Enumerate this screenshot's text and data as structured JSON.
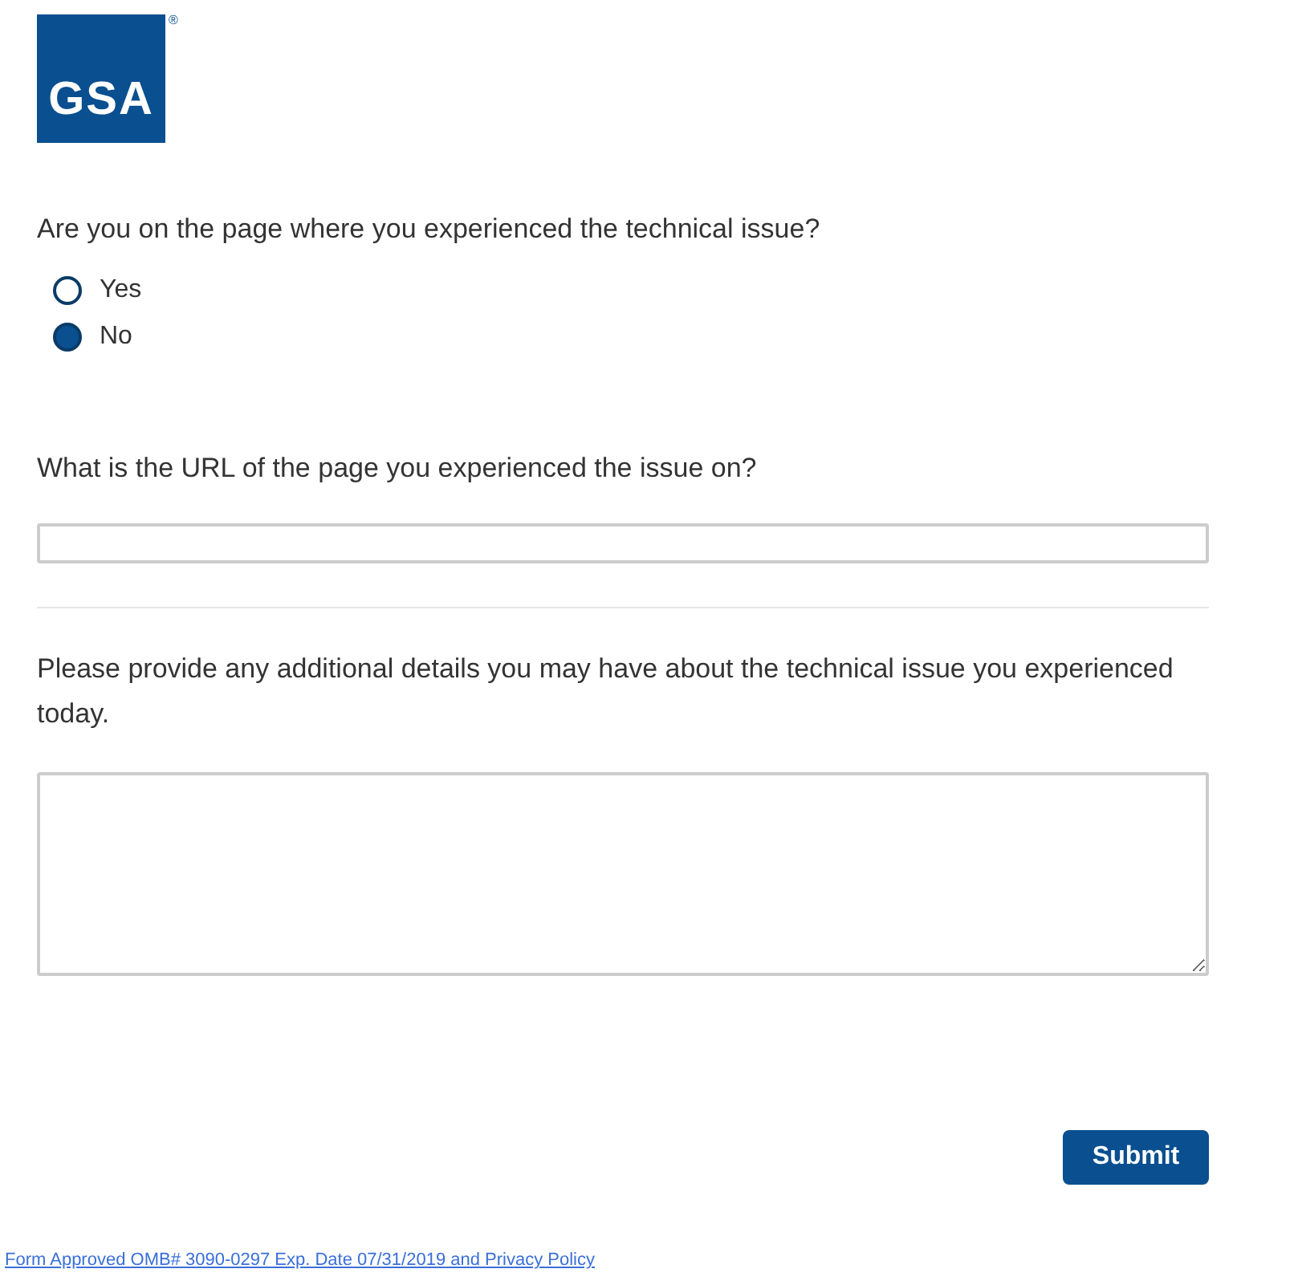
{
  "logo": {
    "text": "GSA",
    "mark": "®"
  },
  "question_1": {
    "label": "Are you on the page where you experienced the technical issue?",
    "options": [
      {
        "label": "Yes",
        "selected": false
      },
      {
        "label": "No",
        "selected": true
      }
    ]
  },
  "question_2": {
    "label": "What is the URL of the page you experienced the issue on?"
  },
  "question_3": {
    "label": "Please provide any additional details you may have about the technical issue you experienced today."
  },
  "submit": "Submit",
  "footer_link": "Form Approved OMB# 3090-0297 Exp. Date 07/31/2019 and Privacy Policy"
}
